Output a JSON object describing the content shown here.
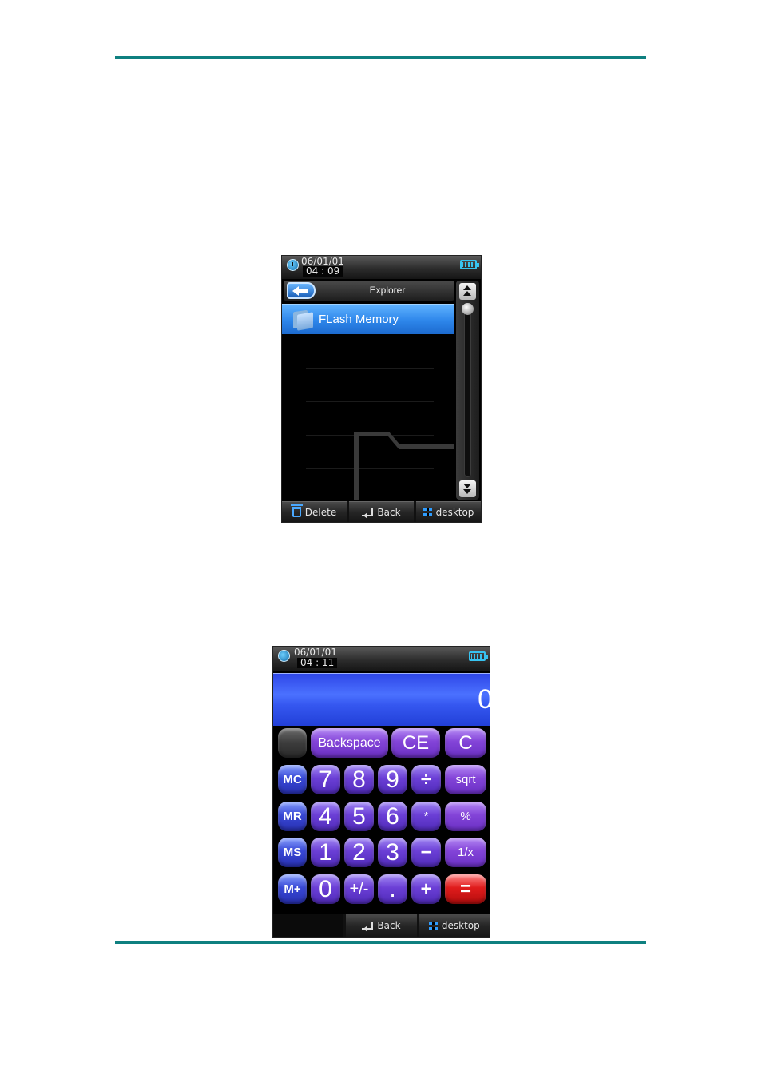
{
  "explorer": {
    "status": {
      "date": "06/01/01",
      "time": "04 : 09"
    },
    "title": "Explorer",
    "items": [
      {
        "label": "FLash Memory"
      }
    ],
    "softkeys": [
      {
        "label": "Delete",
        "icon": "trash-icon"
      },
      {
        "label": "Back",
        "icon": "return-icon"
      },
      {
        "label": "desktop",
        "icon": "grid-icon"
      }
    ]
  },
  "calculator": {
    "status": {
      "date": "06/01/01",
      "time": "04 : 11"
    },
    "display": "0",
    "keys": {
      "backspace": "Backspace",
      "ce": "CE",
      "c": "C",
      "mc": "MC",
      "mr": "MR",
      "ms": "MS",
      "mplus": "M+",
      "k7": "7",
      "k8": "8",
      "k9": "9",
      "div": "÷",
      "sqrt": "sqrt",
      "k4": "4",
      "k5": "5",
      "k6": "6",
      "mul": "*",
      "pct": "%",
      "k1": "1",
      "k2": "2",
      "k3": "3",
      "sub": "−",
      "inv": "1/x",
      "k0": "0",
      "sign": "+/-",
      "dot": ".",
      "add": "+",
      "eq": "="
    },
    "softkeys": [
      {
        "label": "Back",
        "icon": "return-icon"
      },
      {
        "label": "desktop",
        "icon": "grid-icon"
      }
    ]
  },
  "colors": {
    "rule": "#0f8080",
    "selection": "#2d86ea",
    "display": "#3557f0"
  }
}
